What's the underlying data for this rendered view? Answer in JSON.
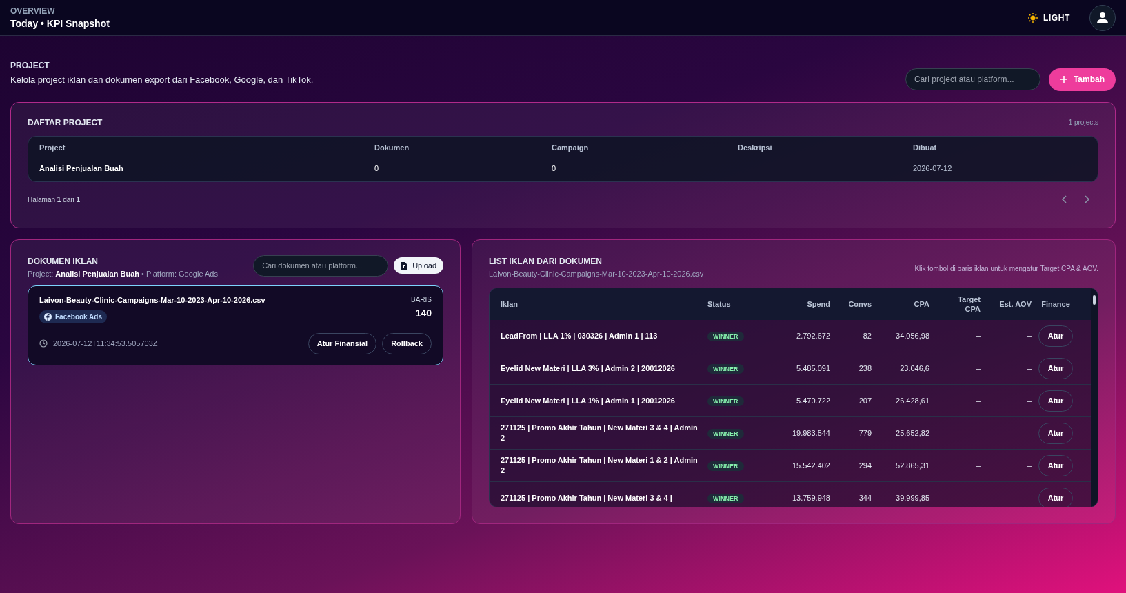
{
  "header": {
    "eyebrow": "OVERVIEW",
    "title": "Today • KPI Snapshot",
    "theme_toggle": "LIGHT"
  },
  "project_section": {
    "title": "PROJECT",
    "description": "Kelola project iklan dan dokumen export dari Facebook, Google, dan TikTok.",
    "search": {
      "placeholder": "Cari project atau platform..."
    },
    "add_button": "Tambah"
  },
  "project_list": {
    "title": "DAFTAR PROJECT",
    "count": "1 projects",
    "columns": [
      "Project",
      "Dokumen",
      "Campaign",
      "Deskripsi",
      "Dibuat"
    ],
    "rows": [
      [
        "Analisi Penjualan Buah",
        "0",
        "0",
        "",
        "2026-07-12"
      ]
    ],
    "pagination": "Halaman **1** dari **1**"
  },
  "documents": {
    "title": "DOKUMEN IKLAN",
    "subtitle": "Project: **Analisi Penjualan Buah** • Platform: Google Ads",
    "search": {
      "placeholder": "Cari dokumen atau platform..."
    },
    "upload_button": "Upload",
    "items": [
      {
        "filename": "Laivon-Beauty-Clinic-Campaigns-Mar-10-2023-Apr-10-2026.csv",
        "platform": "Facebook Ads",
        "rows_label": "BARIS",
        "rows": "140",
        "timestamp": "2026-07-12T11:34:53.505703Z",
        "selected": true,
        "actions": [
          "Atur Finansial",
          "Rollback"
        ]
      }
    ]
  },
  "ads": {
    "title": "LIST IKLAN DARI DOKUMEN",
    "file": "Laivon-Beauty-Clinic-Campaigns-Mar-10-2023-Apr-10-2026.csv",
    "hint": "Klik tombol di baris iklan untuk mengatur Target CPA & AOV.",
    "columns": [
      "Iklan",
      "Status",
      "Spend",
      "Convs",
      "CPA",
      "Target CPA",
      "Est. AOV",
      "Finance"
    ],
    "rows": [
      {
        "name": "LeadFrom | LLA 1% | 030326 | Admin 1 | 113",
        "status": "WINNER",
        "spend": "2.792.672",
        "convs": "82",
        "cpa": "34.056,98",
        "target_cpa": "–",
        "est_aov": "–",
        "action": "Atur"
      },
      {
        "name": "Eyelid New Materi | LLA 3% | Admin 2 | 20012026",
        "status": "WINNER",
        "spend": "5.485.091",
        "convs": "238",
        "cpa": "23.046,6",
        "target_cpa": "–",
        "est_aov": "–",
        "action": "Atur"
      },
      {
        "name": "Eyelid New Materi | LLA 1% | Admin 1 | 20012026",
        "status": "WINNER",
        "spend": "5.470.722",
        "convs": "207",
        "cpa": "26.428,61",
        "target_cpa": "–",
        "est_aov": "–",
        "action": "Atur"
      },
      {
        "name": "271125 | Promo Akhir Tahun | New Materi 3 & 4 | Admin 2",
        "status": "WINNER",
        "spend": "19.983.544",
        "convs": "779",
        "cpa": "25.652,82",
        "target_cpa": "–",
        "est_aov": "–",
        "action": "Atur"
      },
      {
        "name": "271125 | Promo Akhir Tahun | New Materi 1 & 2 | Admin 2",
        "status": "WINNER",
        "spend": "15.542.402",
        "convs": "294",
        "cpa": "52.865,31",
        "target_cpa": "–",
        "est_aov": "–",
        "action": "Atur"
      },
      {
        "name": "271125 | Promo Akhir Tahun | New Materi 3 & 4 |",
        "status": "WINNER",
        "spend": "13.759.948",
        "convs": "344",
        "cpa": "39.999,85",
        "target_cpa": "–",
        "est_aov": "–",
        "action": "Atur"
      }
    ]
  }
}
